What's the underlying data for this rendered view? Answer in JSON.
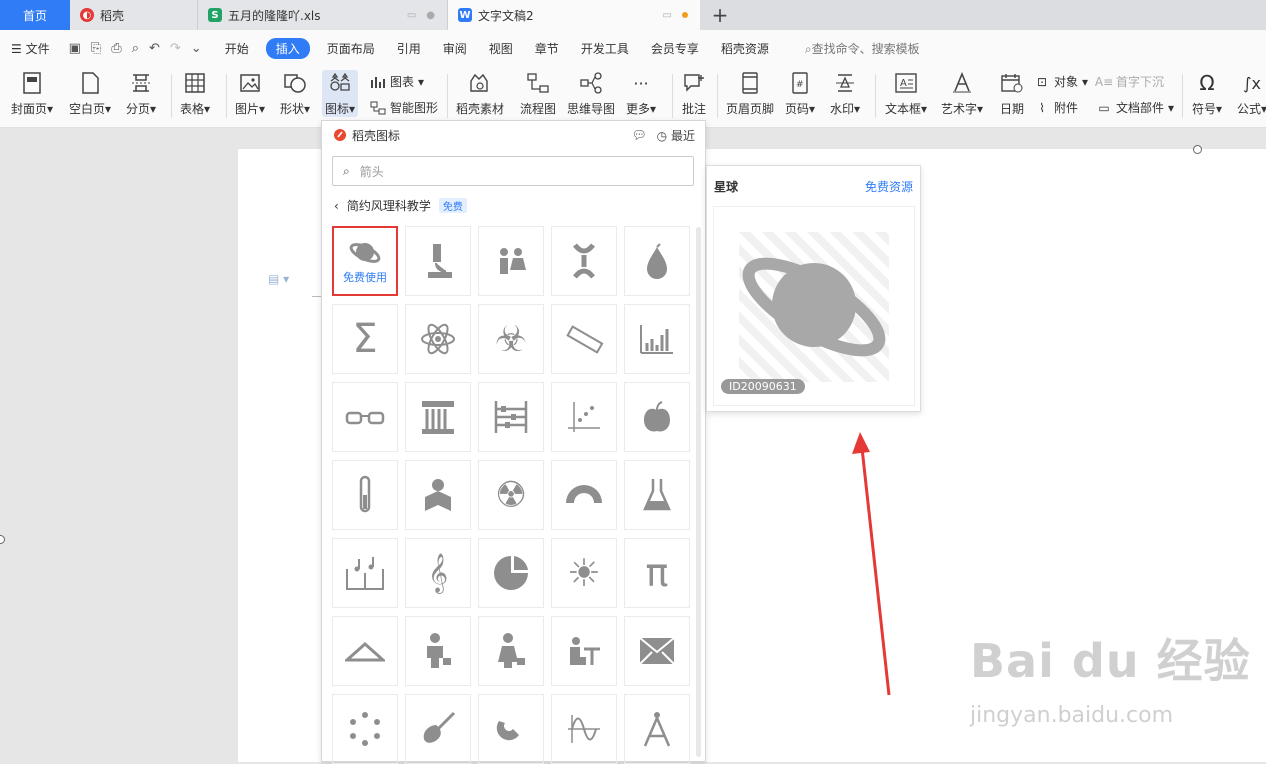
{
  "tabs": {
    "home": "首页",
    "daoke": "稻壳",
    "xls": "五月的隆隆吖.xls",
    "doc": "文字文稿2"
  },
  "menu": {
    "file": "文件",
    "items": [
      "开始",
      "插入",
      "页面布局",
      "引用",
      "审阅",
      "视图",
      "章节",
      "开发工具",
      "会员专享",
      "稻壳资源"
    ],
    "search": "查找命令、搜索模板"
  },
  "ribbon": {
    "cover": "封面页",
    "blank": "空白页",
    "pagebreak": "分页",
    "table": "表格",
    "picture": "图片",
    "shape": "形状",
    "icon": "图标",
    "chart": "图表",
    "smartart": "智能图形",
    "material": "稻壳素材",
    "flow": "流程图",
    "mindmap": "思维导图",
    "more": "更多",
    "comment": "批注",
    "headerfooter": "页眉页脚",
    "pagenum": "页码",
    "watermark": "水印",
    "textbox": "文本框",
    "wordart": "艺术字",
    "date": "日期",
    "object": "对象",
    "dropcap": "首字下沉",
    "attach": "附件",
    "docpart": "文档部件",
    "symbol": "符号",
    "formula": "公式"
  },
  "panel": {
    "title": "稻壳图标",
    "recent": "最近",
    "search_placeholder": "箭头",
    "crumb": "简约风理科教学",
    "free_tag": "免费",
    "free_use": "免费使用"
  },
  "preview": {
    "title": "星球",
    "link": "免费资源",
    "id": "ID20090631"
  },
  "watermark": {
    "main": "Bai du 经验",
    "sub": "jingyan.baidu.com"
  },
  "colors": {
    "accent": "#2f7cf6",
    "highlight": "#e53935",
    "icon_gray": "#8e8e8e"
  }
}
